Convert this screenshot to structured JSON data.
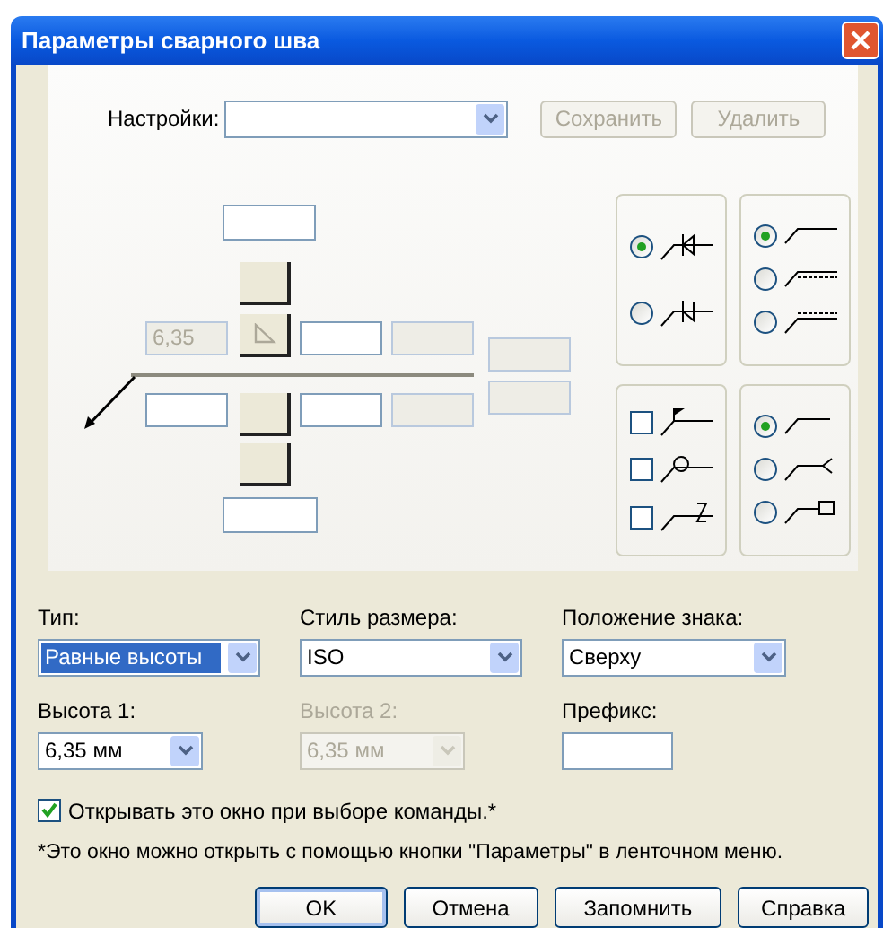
{
  "window": {
    "title": "Параметры сварного шва"
  },
  "settings": {
    "label": "Настройки:",
    "buttons": [
      {
        "label": "Сохранить",
        "disabled": true
      },
      {
        "label": "Удалить",
        "disabled": true
      }
    ]
  },
  "diagram": {
    "fields": [
      {
        "disabled": false
      },
      {
        "value": "6,35",
        "disabled": true
      },
      {
        "disabled": false
      },
      {
        "disabled": true
      },
      {
        "disabled": true
      },
      {
        "disabled": true
      },
      {
        "disabled": false
      },
      {
        "disabled": false
      },
      {
        "disabled": true
      },
      {
        "disabled": false
      }
    ]
  },
  "option_groups": [
    {
      "kind": "radio",
      "options": [
        {
          "selected": true
        },
        {
          "selected": false
        }
      ]
    },
    {
      "kind": "radio",
      "options": [
        {
          "selected": true
        },
        {
          "selected": false
        },
        {
          "selected": false
        }
      ]
    },
    {
      "kind": "checkbox",
      "options": [
        {
          "checked": false
        },
        {
          "checked": false
        },
        {
          "checked": false
        }
      ]
    },
    {
      "kind": "radio",
      "options": [
        {
          "selected": true
        },
        {
          "selected": false
        },
        {
          "selected": false
        }
      ]
    }
  ],
  "fields": [
    {
      "kind": "dropdown",
      "label": "Тип:",
      "value": "Равные высоты",
      "focused": true,
      "disabled": false
    },
    {
      "kind": "dropdown",
      "label": "Стиль размера:",
      "value": "ISO",
      "focused": false,
      "disabled": false
    },
    {
      "kind": "dropdown",
      "label": "Положение знака:",
      "value": "Сверху",
      "focused": false,
      "disabled": false
    },
    {
      "kind": "dropdown",
      "label": "Высота 1:",
      "value": "6,35 мм",
      "focused": false,
      "disabled": false
    },
    {
      "kind": "dropdown",
      "label": "Высота 2:",
      "value": "6,35 мм",
      "focused": false,
      "disabled": true
    },
    {
      "kind": "text",
      "label": "Префикс:",
      "disabled": false
    }
  ],
  "show_on_command": {
    "label": "Открывать это окно при выборе команды.*",
    "checked": true
  },
  "footnote": "*Это окно можно открыть с помощью кнопки \"Параметры\" в ленточном меню.",
  "buttons": [
    {
      "label": "OK",
      "default": true
    },
    {
      "label": "Отмена",
      "default": false
    },
    {
      "label": "Запомнить",
      "default": false
    },
    {
      "label": "Справка",
      "default": false
    }
  ]
}
